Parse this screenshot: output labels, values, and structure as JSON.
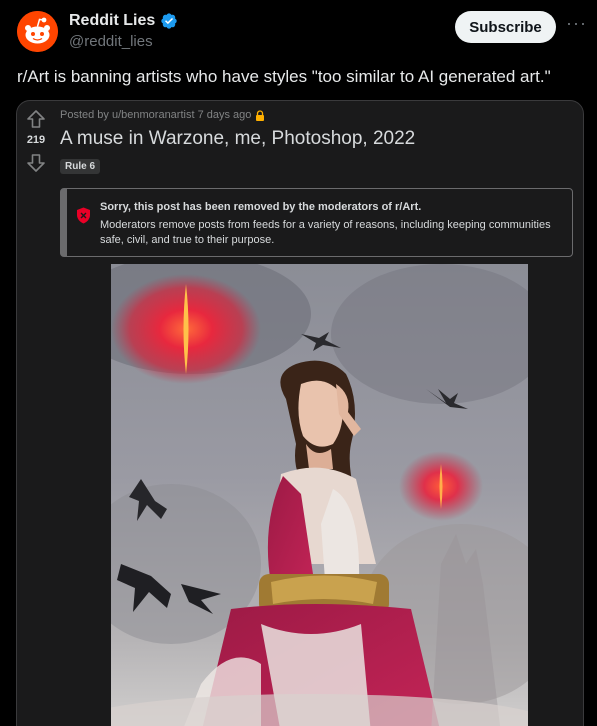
{
  "tweet": {
    "display_name": "Reddit Lies",
    "handle": "@reddit_lies",
    "subscribe_label": "Subscribe",
    "more_label": "···",
    "text": "r/Art is banning artists who have styles \"too similar to AI generated art.\""
  },
  "post": {
    "score": "219",
    "posted_by": "Posted by u/benmoranartist 7 days ago",
    "title": "A muse in Warzone, me, Photoshop, 2022",
    "flair": "Rule 6",
    "removed_title": "Sorry, this post has been removed by the moderators of r/Art.",
    "removed_body": "Moderators remove posts from feeds for a variety of reasons, including keeping communities safe, civil, and true to their purpose."
  },
  "icons": {
    "avatar": "reddit-logo-icon",
    "verified": "verified-badge-icon",
    "upvote": "upvote-arrow-icon",
    "downvote": "downvote-arrow-icon",
    "lock": "lock-icon",
    "removed": "removed-shield-icon"
  },
  "colors": {
    "background": "#000000",
    "card": "#1a1a1b",
    "reddit_orange": "#ff4500",
    "verified_blue": "#1d9bf0",
    "lock_gold": "#ffb000",
    "removed_red": "#ea0027"
  }
}
